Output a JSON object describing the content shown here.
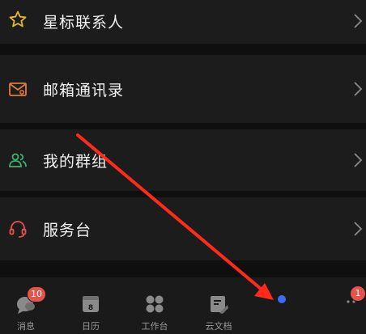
{
  "menu": {
    "items": [
      {
        "label": "星标联系人",
        "icon": "star-icon",
        "color": "#e8b923"
      },
      {
        "label": "邮箱通讯录",
        "icon": "mail-contact-icon",
        "color": "#e07b39"
      },
      {
        "label": "我的群组",
        "icon": "group-icon",
        "color": "#3cb46e"
      },
      {
        "label": "服务台",
        "icon": "headset-icon",
        "color": "#e5534b"
      }
    ]
  },
  "tabbar": {
    "tabs": [
      {
        "label": "消息",
        "icon": "chat-bubble-icon",
        "badge": "10"
      },
      {
        "label": "日历",
        "icon": "calendar-icon",
        "badge": ""
      },
      {
        "label": "工作台",
        "icon": "grid-apps-icon",
        "badge": ""
      },
      {
        "label": "云文档",
        "icon": "cloud-doc-icon",
        "badge": ""
      },
      {
        "label": "",
        "icon": "contacts-icon",
        "badge": ""
      },
      {
        "label": "",
        "icon": "more-icon",
        "badge": "1"
      }
    ]
  },
  "annotation": {
    "color": "#ff2a1a",
    "icon": "red-arrow-annotation"
  },
  "colors": {
    "background": "#0f0f0f",
    "row": "#1c1c1c",
    "active_dot": "#3b6cf5"
  }
}
